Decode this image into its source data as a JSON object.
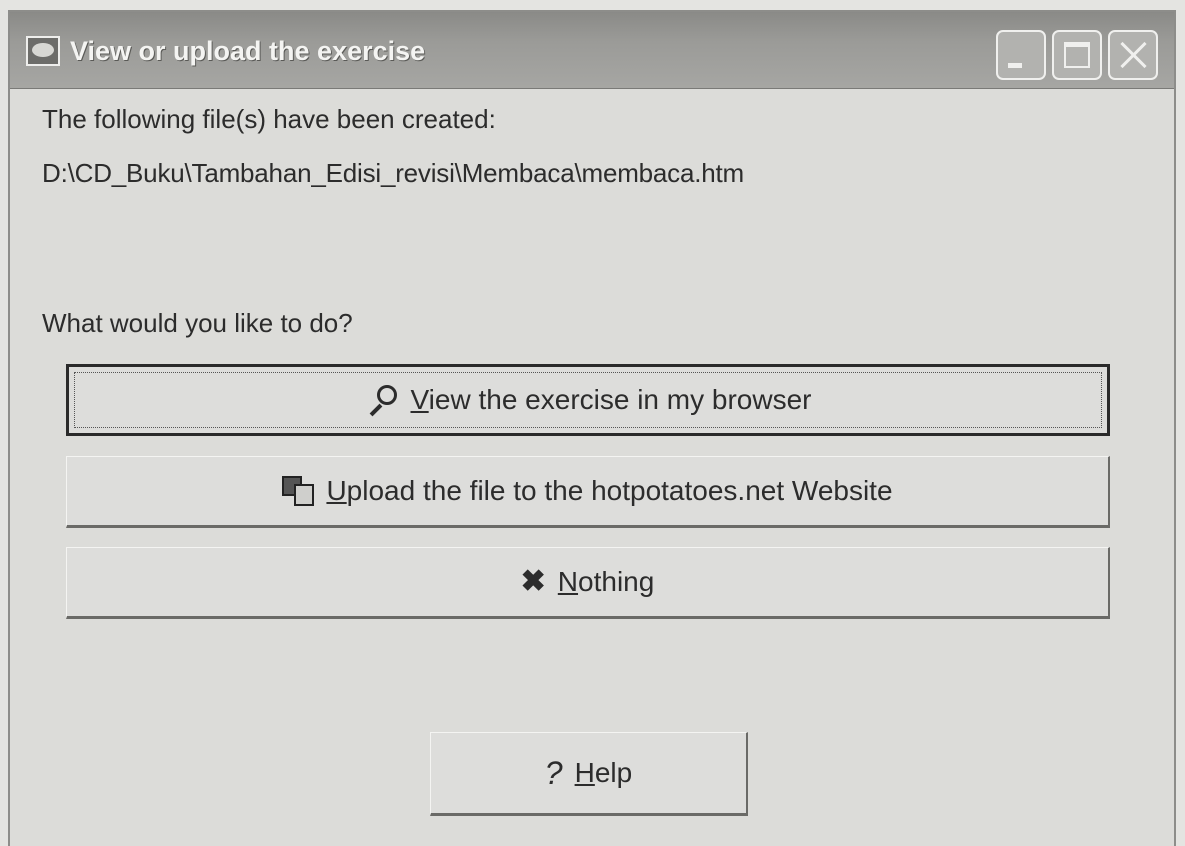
{
  "window": {
    "title": "View or upload the exercise"
  },
  "body": {
    "created_label": "The following file(s) have been created:",
    "file_path": "D:\\CD_Buku\\Tambahan_Edisi_revisi\\Membaca\\membaca.htm",
    "question": "What would you like to do?"
  },
  "buttons": {
    "view": {
      "accel": "V",
      "rest": "iew the exercise in my browser",
      "icon": "magnifier-icon"
    },
    "upload": {
      "accel": "U",
      "rest": "pload the file to the hotpotatoes.net Website",
      "icon": "upload-icon"
    },
    "nothing": {
      "accel": "N",
      "rest": "othing",
      "icon": "x-icon"
    },
    "help": {
      "accel": "H",
      "rest": "elp",
      "icon": "question-icon"
    }
  }
}
